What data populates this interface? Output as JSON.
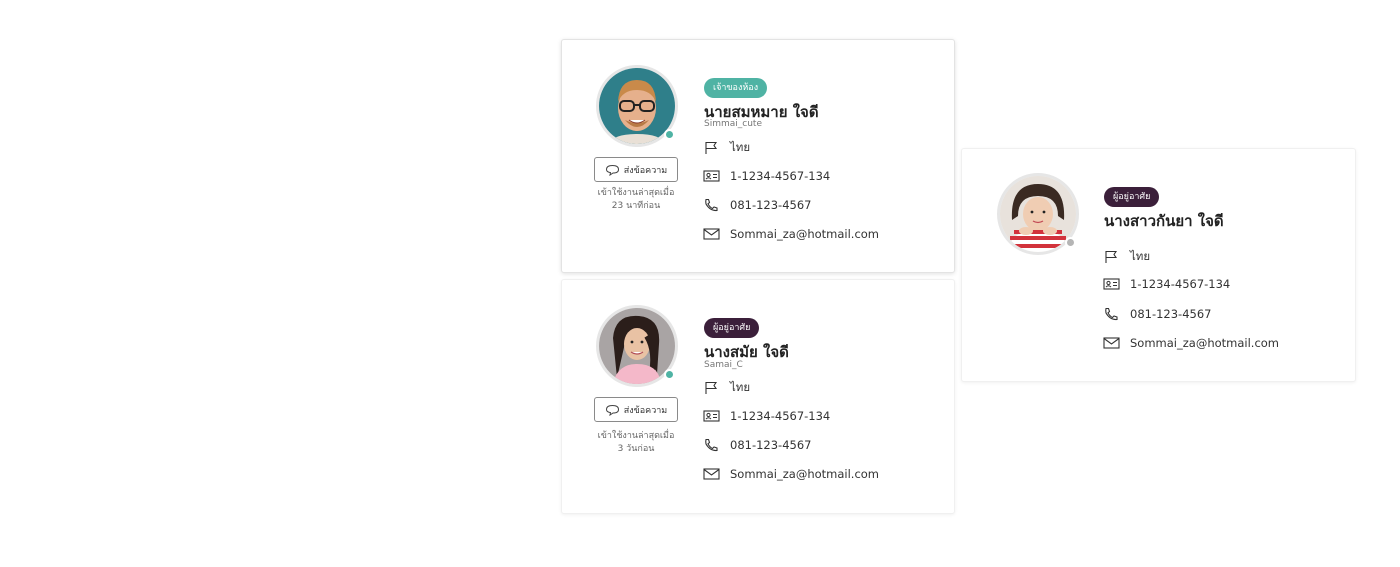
{
  "colors": {
    "teal": "#4fb3a4",
    "plum": "#3b1f3a",
    "online": "#4fb3a4",
    "offline": "#b5b5b5"
  },
  "cards": [
    {
      "badge": "เจ้าของห้อง",
      "badge_color": "#4fb3a4",
      "name": "นายสมหมาย  ใจดี",
      "username": "Simmai_cute",
      "nationality": "ไทย",
      "id_number": "1-1234-4567-134",
      "phone": "081-123-4567",
      "email": "Sommai_za@hotmail.com",
      "message_button": "ส่งข้อความ",
      "last_seen_line1": "เข้าใช้งานล่าสุดเมื่อ",
      "last_seen_line2": "23 นาทีก่อน",
      "status": "online"
    },
    {
      "badge": "ผู้อยู่อาศัย",
      "badge_color": "#3b1f3a",
      "name": "นางสมัย  ใจดี",
      "username": "Samai_C",
      "nationality": "ไทย",
      "id_number": "1-1234-4567-134",
      "phone": "081-123-4567",
      "email": "Sommai_za@hotmail.com",
      "message_button": "ส่งข้อความ",
      "last_seen_line1": "เข้าใช้งานล่าสุดเมื่อ",
      "last_seen_line2": "3 วันก่อน",
      "status": "online"
    },
    {
      "badge": "ผู้อยู่อาศัย",
      "badge_color": "#3b1f3a",
      "name": "นางสาวกันยา  ใจดี",
      "nationality": "ไทย",
      "id_number": "1-1234-4567-134",
      "phone": "081-123-4567",
      "email": "Sommai_za@hotmail.com",
      "status": "offline"
    }
  ],
  "icons": {
    "flag": "flag-icon",
    "id": "id-card-icon",
    "phone": "phone-icon",
    "mail": "mail-icon",
    "chat": "chat-bubble-icon"
  }
}
